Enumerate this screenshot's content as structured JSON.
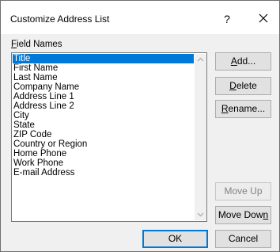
{
  "window": {
    "title": "Customize Address List",
    "help_glyph": "?"
  },
  "field_names": {
    "label_prefix": "F",
    "label_rest": "ield Names",
    "selected_index": 0,
    "items": [
      "Title",
      "First Name",
      "Last Name",
      "Company Name",
      "Address Line 1",
      "Address Line 2",
      "City",
      "State",
      "ZIP Code",
      "Country or Region",
      "Home Phone",
      "Work Phone",
      "E-mail Address"
    ]
  },
  "buttons": {
    "add": {
      "mnemonic": "A",
      "rest": "dd..."
    },
    "delete": {
      "mnemonic": "D",
      "rest": "elete"
    },
    "rename": {
      "mnemonic": "R",
      "rest": "ename..."
    },
    "move_up": "Move Up",
    "move_down": {
      "prefix": "Move Dow",
      "mnemonic": "n"
    },
    "ok": "OK",
    "cancel": "Cancel"
  },
  "icons": {
    "close": "close-icon",
    "scroll_up": "chevron-up-icon",
    "scroll_down": "chevron-down-icon"
  },
  "colors": {
    "selection": "#0078d7",
    "default_button_border": "#0078d7"
  }
}
